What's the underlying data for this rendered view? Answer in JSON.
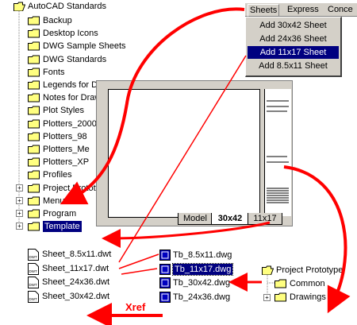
{
  "tree": {
    "root": "AutoCAD Standards",
    "items": [
      {
        "label": "Backup"
      },
      {
        "label": "Desktop Icons"
      },
      {
        "label": "DWG Sample Sheets"
      },
      {
        "label": "DWG Standards"
      },
      {
        "label": "Fonts"
      },
      {
        "label": "Legends for D"
      },
      {
        "label": "Notes for Draw"
      },
      {
        "label": "Plot Styles"
      },
      {
        "label": "Plotters_2000"
      },
      {
        "label": "Plotters_98"
      },
      {
        "label": "Plotters_Me"
      },
      {
        "label": "Plotters_XP"
      },
      {
        "label": "Profiles"
      },
      {
        "label": "Project Prototy",
        "expander": "+"
      },
      {
        "label": "Menu",
        "expander": "+"
      },
      {
        "label": "Program",
        "expander": "+"
      },
      {
        "label": "Template",
        "expander": "+",
        "selected": true
      }
    ]
  },
  "menubar": {
    "items": [
      "Sheets",
      "Express",
      "Conce"
    ]
  },
  "sheets_menu": {
    "items": [
      {
        "label": "Add 30x42 Sheet",
        "selected": false
      },
      {
        "label": "Add 24x36 Sheet",
        "selected": false
      },
      {
        "label": "Add 11x17 Sheet",
        "selected": true
      },
      {
        "label": "Add 8.5x11 Sheet",
        "selected": false
      }
    ]
  },
  "layout_tabs": [
    "Model",
    "30x42",
    "11x17"
  ],
  "templates": [
    "Sheet_8.5x11.dwt",
    "Sheet_11x17.dwt",
    "Sheet_24x36.dwt",
    "Sheet_30x42.dwt"
  ],
  "title_blocks": [
    {
      "label": "Tb_8.5x11.dwg",
      "selected": false
    },
    {
      "label": "Tb_11x17.dwg",
      "selected": true
    },
    {
      "label": "Tb_30x42.dwg",
      "selected": false
    },
    {
      "label": "Tb_24x36.dwg",
      "selected": false
    }
  ],
  "prototype_tree": {
    "root": "Project Prototype",
    "children": [
      "Common",
      "Drawings"
    ]
  },
  "xref_label": "Xref",
  "colors": {
    "arrow": "#ff0000",
    "selection": "#000080",
    "folder": "#ffff80",
    "menu_bg": "#d4d0c8"
  }
}
